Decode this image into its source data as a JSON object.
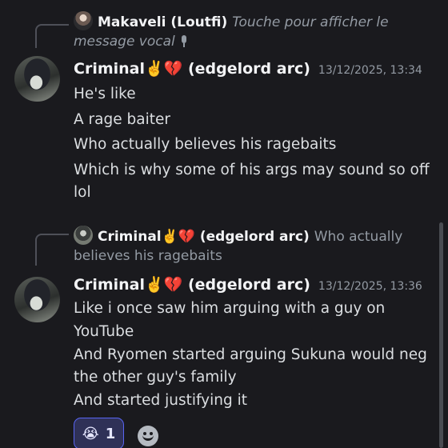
{
  "reply_1": {
    "author": "Makaveli (Loutfi)",
    "preview": "Touche pour afficher le message vocal"
  },
  "message_1": {
    "author_name": "Criminal",
    "author_emojis": "✌️💔",
    "author_suffix": "(edgelord arc)",
    "timestamp": "13/12/2025, 13:34",
    "lines": [
      "He's like",
      "A rage baiter",
      "Who actually believes his ragebaits",
      "Which is why some of his args may sound so off",
      "lol"
    ]
  },
  "reply_2": {
    "author": "Criminal✌️💔 (edgelord arc)",
    "preview": "Who actually believes his ragebaits"
  },
  "message_2": {
    "author_name": "Criminal",
    "author_emojis": "✌️💔",
    "author_suffix": "(edgelord arc)",
    "timestamp": "13/12/2025, 13:36",
    "lines": [
      "Like i once saw him arguing with a guy on",
      "YouTube",
      "And Ryomen started arguing Sukuna would neg",
      "the other guy's family",
      "And started justifying it"
    ]
  },
  "reaction": {
    "emoji": "😭",
    "count": "1"
  },
  "icons": {
    "mic": "microphone-icon",
    "add_reaction": "add-reaction-smiley-icon"
  },
  "colors": {
    "background": "#1a1a1e",
    "reaction_bg": "#2f3157",
    "reaction_border": "#5865f2",
    "muted_text": "#949ba4"
  }
}
